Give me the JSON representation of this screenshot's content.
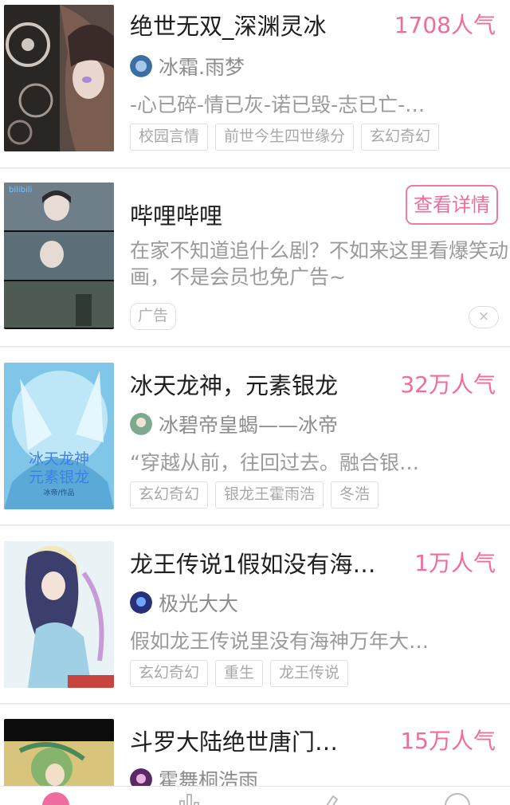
{
  "colors": {
    "accent_pink": "#f06b9e",
    "title_text": "#1f1f1f",
    "meta_text": "#9a9a9a",
    "tag_border": "#e0e0e0",
    "divider": "#ececec"
  },
  "works": [
    {
      "title": "绝世无双_深渊灵冰",
      "popularity": "1708人气",
      "author": "冰霜.雨梦",
      "description": "-心已碎-情已灰-诺已毁-志已亡-…",
      "tags": [
        "校园言情",
        "前世今生四世缘分",
        "玄幻奇幻"
      ]
    },
    {
      "title": "冰天龙神，元素银龙",
      "popularity": "32万人气",
      "author": "冰碧帝皇蝎——冰帝",
      "description": "“穿越从前，往回过去。融合银…",
      "tags": [
        "玄幻奇幻",
        "银龙王霍雨浩",
        "冬浩"
      ],
      "cover_text": [
        "冰天龙神",
        "元素银龙",
        "冰帝/作品"
      ]
    },
    {
      "title": "龙王传说1假如没有海…",
      "popularity": "1万人气",
      "author": "极光大大",
      "description": "假如龙王传说里没有海神万年大…",
      "tags": [
        "玄幻奇幻",
        "重生",
        "龙王传说"
      ]
    },
    {
      "title": "斗罗大陆绝世唐门…",
      "popularity": "15万人气",
      "author": "霍舞桐浩雨",
      "description": "",
      "tags": []
    }
  ],
  "ad": {
    "title": "哔哩哔哩",
    "button_label": "查看详情",
    "description": "在家不知道追什么剧？不如来这里看爆笑动画，不是会员也免广告~",
    "tag": "广告",
    "close_icon": "×",
    "cover_logo": "bilibili"
  },
  "tabbar": {
    "icons": [
      "home-icon",
      "ranking-icon",
      "write-icon",
      "profile-icon"
    ]
  }
}
